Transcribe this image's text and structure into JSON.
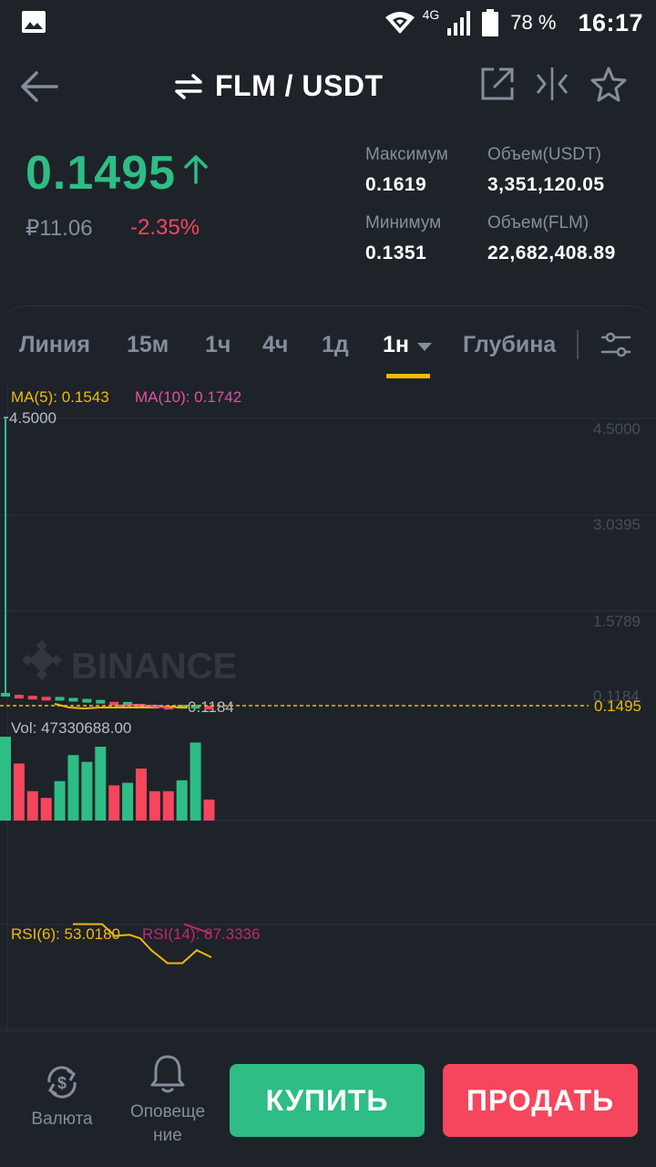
{
  "status_bar": {
    "network": "4G",
    "battery": "78 %",
    "time": "16:17"
  },
  "header": {
    "pair": "FLM / USDT"
  },
  "ticker": {
    "price": "0.1495",
    "price_rub": "₽11.06",
    "change_pct": "-2.35%",
    "high_label": "Максимум",
    "high_value": "0.1619",
    "low_label": "Минимум",
    "low_value": "0.1351",
    "vol_quote_label": "Объем(USDT)",
    "vol_quote_value": "3,351,120.05",
    "vol_base_label": "Объем(FLM)",
    "vol_base_value": "22,682,408.89"
  },
  "tabs": [
    {
      "label": "Линия"
    },
    {
      "label": "15м"
    },
    {
      "label": "1ч"
    },
    {
      "label": "4ч"
    },
    {
      "label": "1д"
    },
    {
      "label": "1н",
      "active": true
    },
    {
      "label": "Глубина"
    }
  ],
  "indicators": {
    "ma5": "MA(5): 0.1543",
    "ma10": "MA(10): 0.1742",
    "vol": "Vol: 47330688.00",
    "rsi6": "RSI(6): 53.0180",
    "rsi14": "RSI(14): 87.3336"
  },
  "chart_data": {
    "type": "candlestick",
    "price_axis_labels": [
      "4.5000",
      "3.0395",
      "1.5789",
      "0.1184"
    ],
    "max_label": "4.5000",
    "min_label": "0.1184",
    "last_price_label": "0.1495",
    "watermark": "BINANCE",
    "volume_bars": [
      {
        "color": "up",
        "value": 1.0
      },
      {
        "color": "down",
        "value": 0.68
      },
      {
        "color": "down",
        "value": 0.35
      },
      {
        "color": "down",
        "value": 0.27
      },
      {
        "color": "up",
        "value": 0.47
      },
      {
        "color": "up",
        "value": 0.78
      },
      {
        "color": "up",
        "value": 0.7
      },
      {
        "color": "up",
        "value": 0.88
      },
      {
        "color": "down",
        "value": 0.42
      },
      {
        "color": "up",
        "value": 0.45
      },
      {
        "color": "down",
        "value": 0.62
      },
      {
        "color": "down",
        "value": 0.35
      },
      {
        "color": "down",
        "value": 0.35
      },
      {
        "color": "up",
        "value": 0.48
      },
      {
        "color": "up",
        "value": 0.93
      },
      {
        "color": "down",
        "value": 0.25
      }
    ],
    "rsi6_values": [
      88,
      88,
      88,
      78,
      79,
      76,
      66,
      55,
      55,
      66,
      60
    ],
    "rsi14_values": [
      88,
      80
    ]
  },
  "colors": {
    "up": "#2ebd85",
    "down": "#f6465d",
    "accent": "#f0b90b",
    "ma10": "#e052a0",
    "rsi14": "#c2286d"
  },
  "bottom_nav": {
    "currency_label": "Валюта",
    "alerts_label_1": "Оповеще",
    "alerts_label_2": "ние",
    "buy_label": "КУПИТЬ",
    "sell_label": "ПРОДАТЬ"
  }
}
